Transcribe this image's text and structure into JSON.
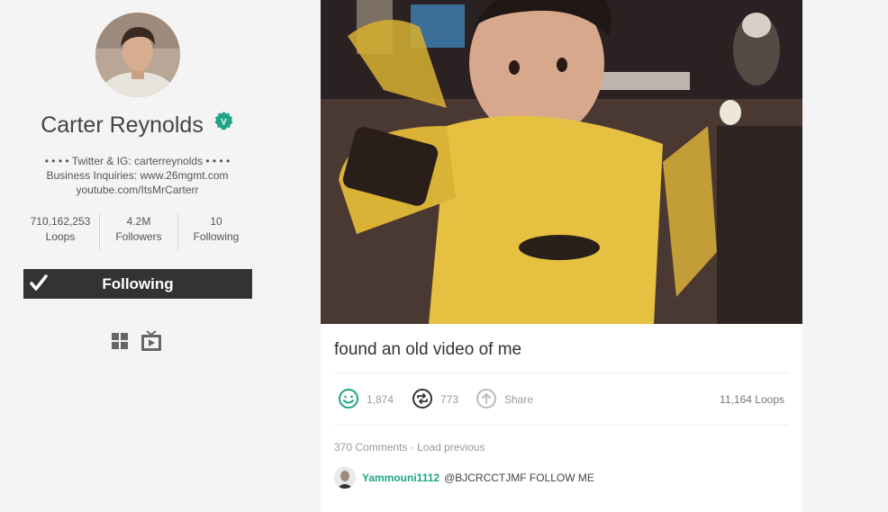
{
  "profile": {
    "name": "Carter Reynolds",
    "bio": [
      "• • • • Twitter & IG: carterreynolds • • • •",
      "Business Inquiries: www.26mgmt.com",
      "youtube.com/ItsMrCarterr"
    ],
    "stats": [
      {
        "value": "710,162,253",
        "label": "Loops"
      },
      {
        "value": "4.2M",
        "label": "Followers"
      },
      {
        "value": "10",
        "label": "Following"
      }
    ],
    "follow_label": "Following"
  },
  "post": {
    "caption": "found an old video of me",
    "likes": "1,874",
    "revines": "773",
    "share_label": "Share",
    "loops_count": "11,164",
    "loops_label": "Loops",
    "comments_count": "370 Comments",
    "load_previous": "Load previous",
    "comment": {
      "user": "Yammouni1112",
      "text": "@BJCRCCTJMF FOLLOW ME"
    }
  },
  "colors": {
    "accent": "#1fa583",
    "button": "#333333",
    "background": "#f4f4f4"
  },
  "icons": [
    "verified-badge-icon",
    "checkmark-icon",
    "grid-view-icon",
    "tv-view-icon",
    "smiley-like-icon",
    "revine-icon",
    "share-icon"
  ]
}
